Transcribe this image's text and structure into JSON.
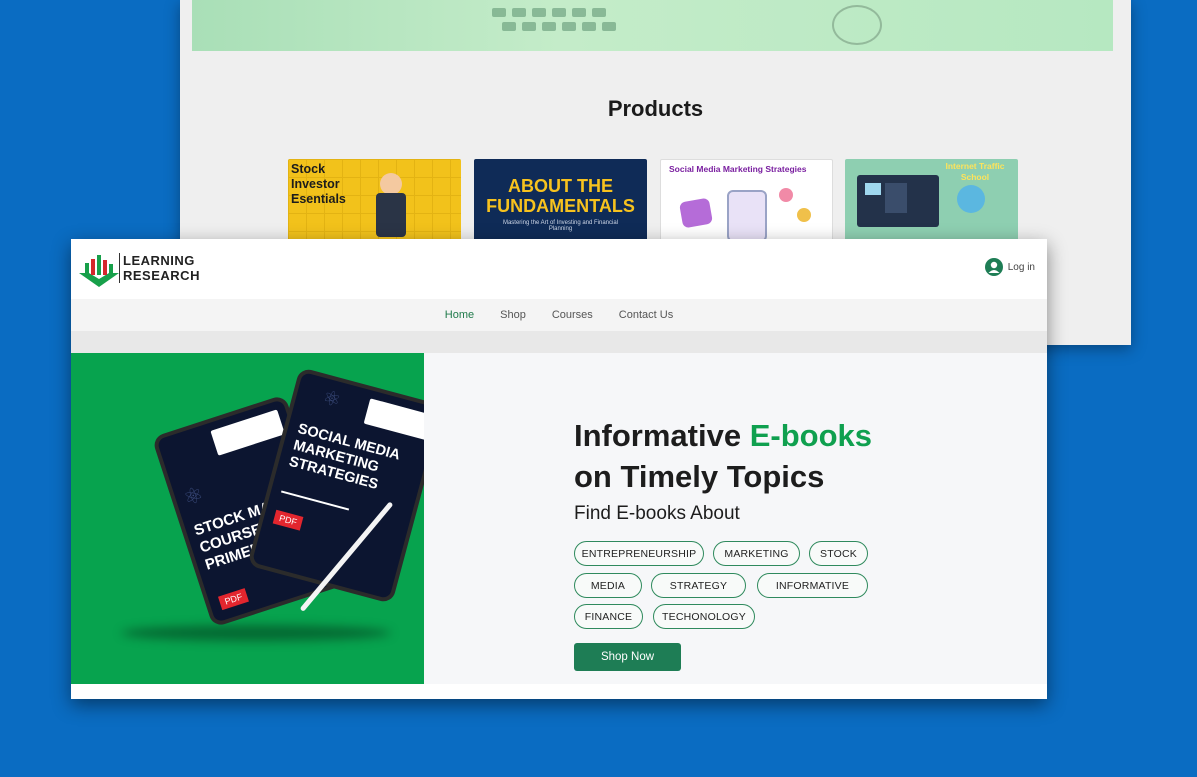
{
  "back_page": {
    "section_title": "Products",
    "products": [
      {
        "label": "Stock Investor Esentials"
      },
      {
        "label": "ABOUT THE FUNDAMENTALS",
        "sub": "Mastering the Art of Investing and Financial Planning"
      },
      {
        "label": "Social Media Marketing Strategies"
      },
      {
        "label": "Internet Traffic School"
      }
    ]
  },
  "header": {
    "logo_line1": "LEARNING",
    "logo_line2": "RESEARCH",
    "login_label": "Log in"
  },
  "nav": {
    "items": [
      {
        "label": "Home"
      },
      {
        "label": "Shop"
      },
      {
        "label": "Courses"
      },
      {
        "label": "Contact Us"
      }
    ]
  },
  "hero": {
    "title_part1": "Informative ",
    "title_highlight": "E-books",
    "title_line2": "on Timely Topics",
    "subtitle": "Find E-books About",
    "tags": [
      "ENTREPRENEURSHIP",
      "MARKETING",
      "STOCK",
      "MEDIA",
      "STRATEGY",
      "INFORMATIVE",
      "FINANCE",
      "TECHONOLOGY"
    ],
    "cta_label": "Shop Now",
    "tablet_back_title": "STOCK MARKET COURSE AND PRIMER",
    "tablet_front_title": "SOCIAL MEDIA MARKETING STRATEGIES",
    "pdf_label": "PDF"
  },
  "colors": {
    "background": "#0a6cc2",
    "accent_green": "#0fa04f",
    "button_green": "#1e7d55"
  }
}
